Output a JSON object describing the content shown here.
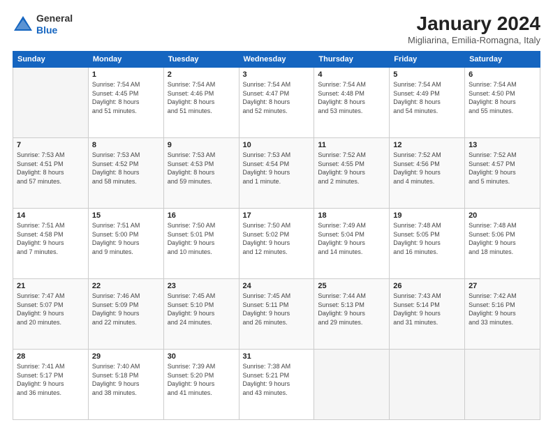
{
  "header": {
    "logo_general": "General",
    "logo_blue": "Blue",
    "title": "January 2024",
    "subtitle": "Migliarina, Emilia-Romagna, Italy"
  },
  "calendar": {
    "days_of_week": [
      "Sunday",
      "Monday",
      "Tuesday",
      "Wednesday",
      "Thursday",
      "Friday",
      "Saturday"
    ],
    "weeks": [
      [
        {
          "day": "",
          "info": ""
        },
        {
          "day": "1",
          "info": "Sunrise: 7:54 AM\nSunset: 4:45 PM\nDaylight: 8 hours\nand 51 minutes."
        },
        {
          "day": "2",
          "info": "Sunrise: 7:54 AM\nSunset: 4:46 PM\nDaylight: 8 hours\nand 51 minutes."
        },
        {
          "day": "3",
          "info": "Sunrise: 7:54 AM\nSunset: 4:47 PM\nDaylight: 8 hours\nand 52 minutes."
        },
        {
          "day": "4",
          "info": "Sunrise: 7:54 AM\nSunset: 4:48 PM\nDaylight: 8 hours\nand 53 minutes."
        },
        {
          "day": "5",
          "info": "Sunrise: 7:54 AM\nSunset: 4:49 PM\nDaylight: 8 hours\nand 54 minutes."
        },
        {
          "day": "6",
          "info": "Sunrise: 7:54 AM\nSunset: 4:50 PM\nDaylight: 8 hours\nand 55 minutes."
        }
      ],
      [
        {
          "day": "7",
          "info": "Sunrise: 7:53 AM\nSunset: 4:51 PM\nDaylight: 8 hours\nand 57 minutes."
        },
        {
          "day": "8",
          "info": "Sunrise: 7:53 AM\nSunset: 4:52 PM\nDaylight: 8 hours\nand 58 minutes."
        },
        {
          "day": "9",
          "info": "Sunrise: 7:53 AM\nSunset: 4:53 PM\nDaylight: 8 hours\nand 59 minutes."
        },
        {
          "day": "10",
          "info": "Sunrise: 7:53 AM\nSunset: 4:54 PM\nDaylight: 9 hours\nand 1 minute."
        },
        {
          "day": "11",
          "info": "Sunrise: 7:52 AM\nSunset: 4:55 PM\nDaylight: 9 hours\nand 2 minutes."
        },
        {
          "day": "12",
          "info": "Sunrise: 7:52 AM\nSunset: 4:56 PM\nDaylight: 9 hours\nand 4 minutes."
        },
        {
          "day": "13",
          "info": "Sunrise: 7:52 AM\nSunset: 4:57 PM\nDaylight: 9 hours\nand 5 minutes."
        }
      ],
      [
        {
          "day": "14",
          "info": "Sunrise: 7:51 AM\nSunset: 4:58 PM\nDaylight: 9 hours\nand 7 minutes."
        },
        {
          "day": "15",
          "info": "Sunrise: 7:51 AM\nSunset: 5:00 PM\nDaylight: 9 hours\nand 9 minutes."
        },
        {
          "day": "16",
          "info": "Sunrise: 7:50 AM\nSunset: 5:01 PM\nDaylight: 9 hours\nand 10 minutes."
        },
        {
          "day": "17",
          "info": "Sunrise: 7:50 AM\nSunset: 5:02 PM\nDaylight: 9 hours\nand 12 minutes."
        },
        {
          "day": "18",
          "info": "Sunrise: 7:49 AM\nSunset: 5:04 PM\nDaylight: 9 hours\nand 14 minutes."
        },
        {
          "day": "19",
          "info": "Sunrise: 7:48 AM\nSunset: 5:05 PM\nDaylight: 9 hours\nand 16 minutes."
        },
        {
          "day": "20",
          "info": "Sunrise: 7:48 AM\nSunset: 5:06 PM\nDaylight: 9 hours\nand 18 minutes."
        }
      ],
      [
        {
          "day": "21",
          "info": "Sunrise: 7:47 AM\nSunset: 5:07 PM\nDaylight: 9 hours\nand 20 minutes."
        },
        {
          "day": "22",
          "info": "Sunrise: 7:46 AM\nSunset: 5:09 PM\nDaylight: 9 hours\nand 22 minutes."
        },
        {
          "day": "23",
          "info": "Sunrise: 7:45 AM\nSunset: 5:10 PM\nDaylight: 9 hours\nand 24 minutes."
        },
        {
          "day": "24",
          "info": "Sunrise: 7:45 AM\nSunset: 5:11 PM\nDaylight: 9 hours\nand 26 minutes."
        },
        {
          "day": "25",
          "info": "Sunrise: 7:44 AM\nSunset: 5:13 PM\nDaylight: 9 hours\nand 29 minutes."
        },
        {
          "day": "26",
          "info": "Sunrise: 7:43 AM\nSunset: 5:14 PM\nDaylight: 9 hours\nand 31 minutes."
        },
        {
          "day": "27",
          "info": "Sunrise: 7:42 AM\nSunset: 5:16 PM\nDaylight: 9 hours\nand 33 minutes."
        }
      ],
      [
        {
          "day": "28",
          "info": "Sunrise: 7:41 AM\nSunset: 5:17 PM\nDaylight: 9 hours\nand 36 minutes."
        },
        {
          "day": "29",
          "info": "Sunrise: 7:40 AM\nSunset: 5:18 PM\nDaylight: 9 hours\nand 38 minutes."
        },
        {
          "day": "30",
          "info": "Sunrise: 7:39 AM\nSunset: 5:20 PM\nDaylight: 9 hours\nand 41 minutes."
        },
        {
          "day": "31",
          "info": "Sunrise: 7:38 AM\nSunset: 5:21 PM\nDaylight: 9 hours\nand 43 minutes."
        },
        {
          "day": "",
          "info": ""
        },
        {
          "day": "",
          "info": ""
        },
        {
          "day": "",
          "info": ""
        }
      ]
    ]
  }
}
